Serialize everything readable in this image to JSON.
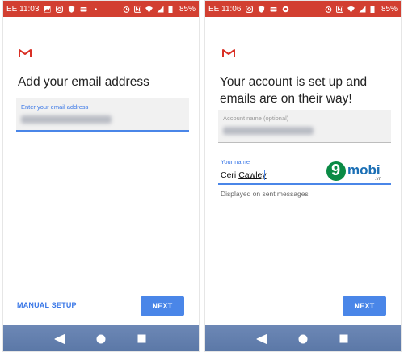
{
  "screens": [
    {
      "status_bar": {
        "time": "EE 11:03",
        "battery": "85%"
      },
      "heading": "Add your email address",
      "email_field": {
        "label": "Enter your email address"
      },
      "manual_setup_label": "MANUAL SETUP",
      "next_label": "NEXT"
    },
    {
      "status_bar": {
        "time": "EE 11:06",
        "battery": "85%"
      },
      "heading": "Your account is set up and emails are on their way!",
      "account_field": {
        "label": "Account name (optional)"
      },
      "name_field": {
        "label": "Your name",
        "value_first": "Ceri",
        "value_last": "Cawley",
        "helper": "Displayed on sent messages"
      },
      "watermark": {
        "main": "mobi",
        "sub": ".vn"
      },
      "next_label": "NEXT"
    }
  ],
  "colors": {
    "status_bar": "#d23f31",
    "accent": "#4a86e8",
    "nav_bar": "#6380af",
    "gmail_red": "#d93025"
  }
}
